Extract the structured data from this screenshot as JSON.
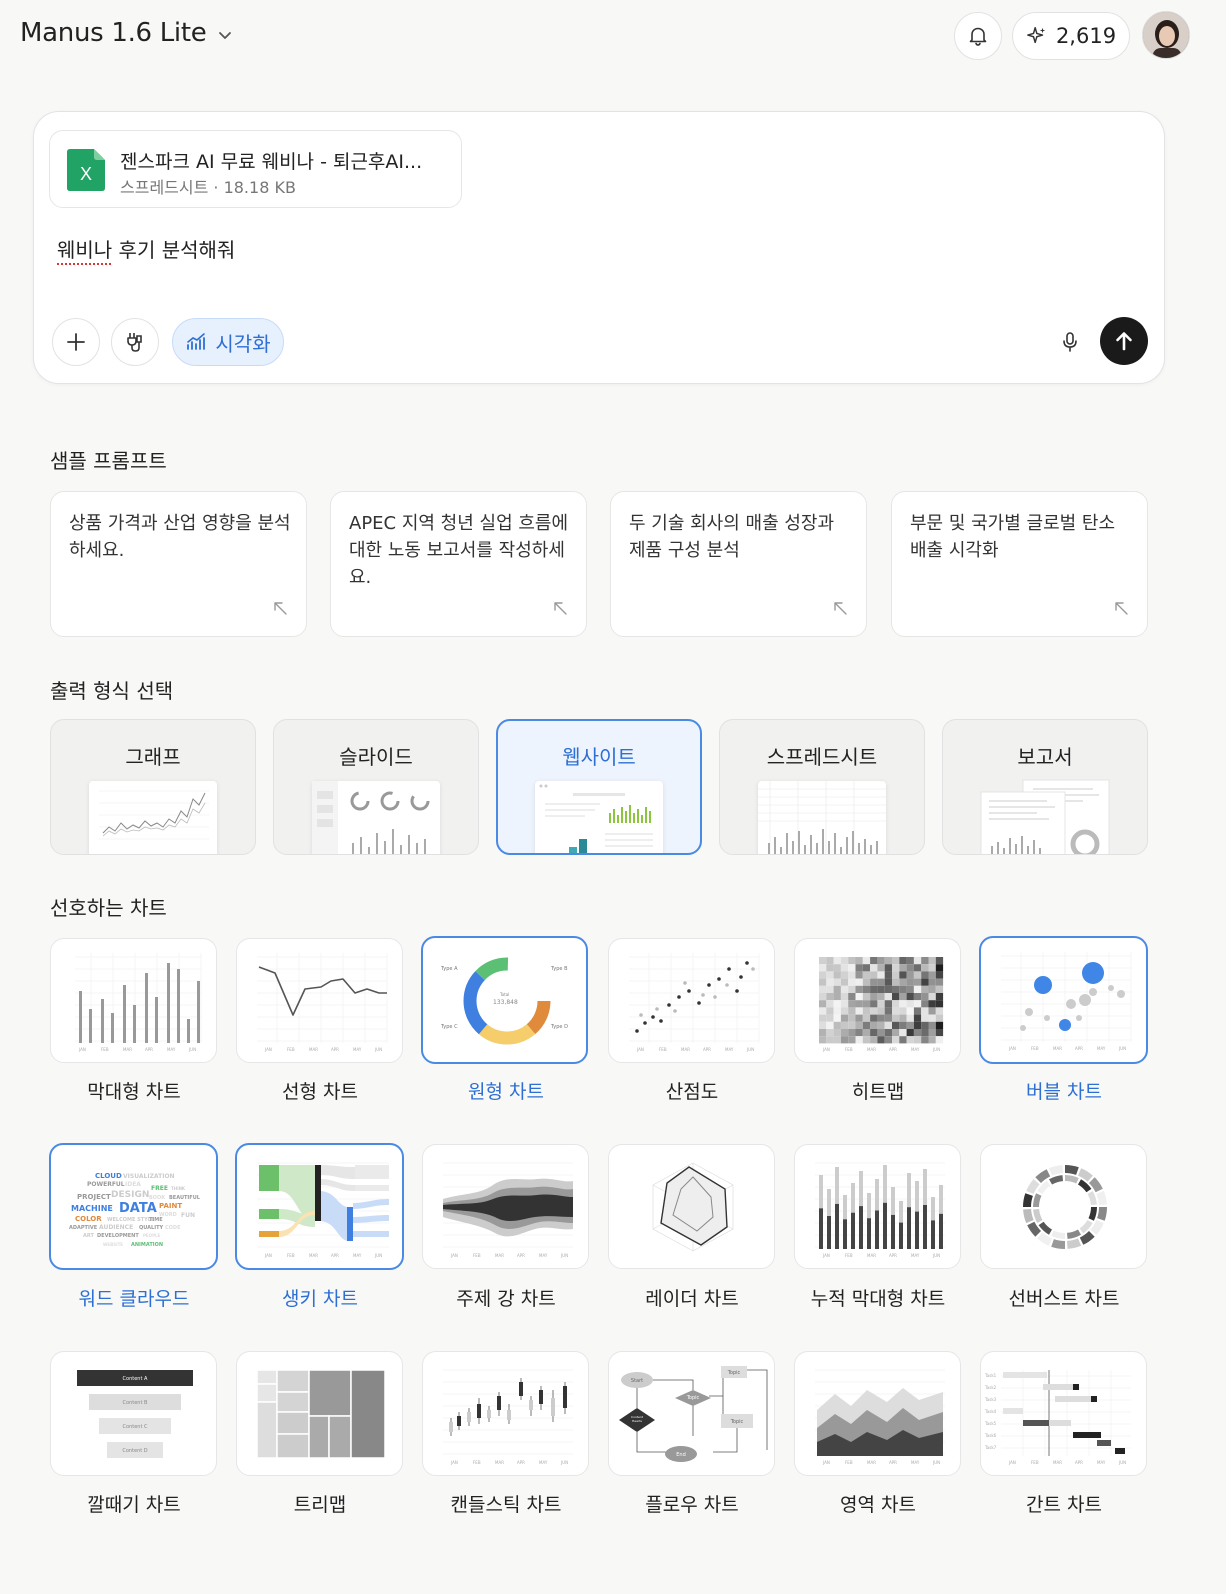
{
  "header": {
    "model_title": "Manus 1.6 Lite",
    "credits": "2,619"
  },
  "composer": {
    "attachment": {
      "name": "젠스파크 AI 무료 웨비나 - 퇴근후AI...",
      "meta": "스프레드시트 · 18.18 KB",
      "file_badge": "X"
    },
    "prompt_misspelled": "웨비나",
    "prompt_rest": " 후기 분석해줘",
    "viz_chip_label": "시각화"
  },
  "sample_prompts": {
    "title": "샘플 프롬프트",
    "items": [
      "상품 가격과 산업 영향을 분석하세요.",
      "APEC 지역 청년 실업 흐름에 대한 노동 보고서를 작성하세요.",
      "두 기술 회사의 매출 성장과 제품 구성 분석",
      "부문 및 국가별 글로벌 탄소 배출 시각화"
    ]
  },
  "output_format": {
    "title": "출력 형식 선택",
    "items": [
      "그래프",
      "슬라이드",
      "웹사이트",
      "스프레드시트",
      "보고서"
    ],
    "selected": "웹사이트"
  },
  "preferred_charts": {
    "title": "선호하는 차트",
    "items": [
      "막대형 차트",
      "선형 차트",
      "원형 차트",
      "산점도",
      "히트맵",
      "버블 차트",
      "워드 클라우드",
      "생키 차트",
      "주제 강 차트",
      "레이더 차트",
      "누적 막대형 차트",
      "선버스트 차트",
      "깔때기 차트",
      "트리맵",
      "캔들스틱 차트",
      "플로우 차트",
      "영역 차트",
      "간트 차트"
    ],
    "selected": [
      "원형 차트",
      "버블 차트",
      "워드 클라우드",
      "생키 차트"
    ]
  },
  "colors": {
    "accent": "#2d6fd3",
    "selected_border": "#4a89e4",
    "send_button": "#1a1a1a",
    "excel_green": "#21a366"
  }
}
